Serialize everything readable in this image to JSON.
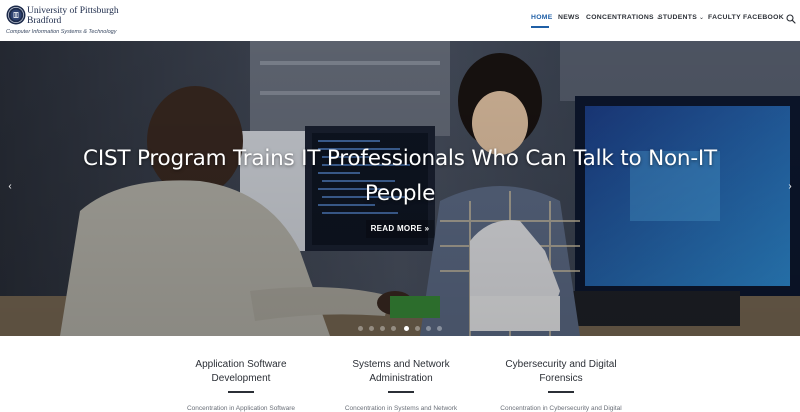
{
  "brand": {
    "name_line1": "University of Pittsburgh",
    "name_line2": "Bradford",
    "subtitle": "Computer Information Systems & Technology",
    "logo_icon": "university-seal-icon"
  },
  "nav": {
    "items": [
      {
        "label": "HOME",
        "active": true
      },
      {
        "label": "NEWS",
        "active": false
      },
      {
        "label": "CONCENTRATIONS",
        "active": false,
        "dropdown": true
      },
      {
        "label": "STUDENTS",
        "active": false,
        "dropdown": true
      },
      {
        "label": "FACULTY",
        "active": false
      },
      {
        "label": "FACEBOOK",
        "active": false
      }
    ],
    "caret": "⌄",
    "search_icon": "search-icon",
    "accent_color": "#1f5fa6"
  },
  "hero": {
    "title": "CIST Program Trains IT Professionals Who Can Talk to Non-IT People",
    "button_label": "READ MORE »",
    "prev_arrow": "‹",
    "next_arrow": "›",
    "slide_count": 8,
    "active_slide": 5
  },
  "concentrations": [
    {
      "title": "Application Software Development",
      "description": "Concentration in Application Software"
    },
    {
      "title": "Systems and Network Administration",
      "description": "Concentration in Systems and Network"
    },
    {
      "title": "Cybersecurity and Digital Forensics",
      "description": "Concentration in Cybersecurity and Digital"
    }
  ]
}
